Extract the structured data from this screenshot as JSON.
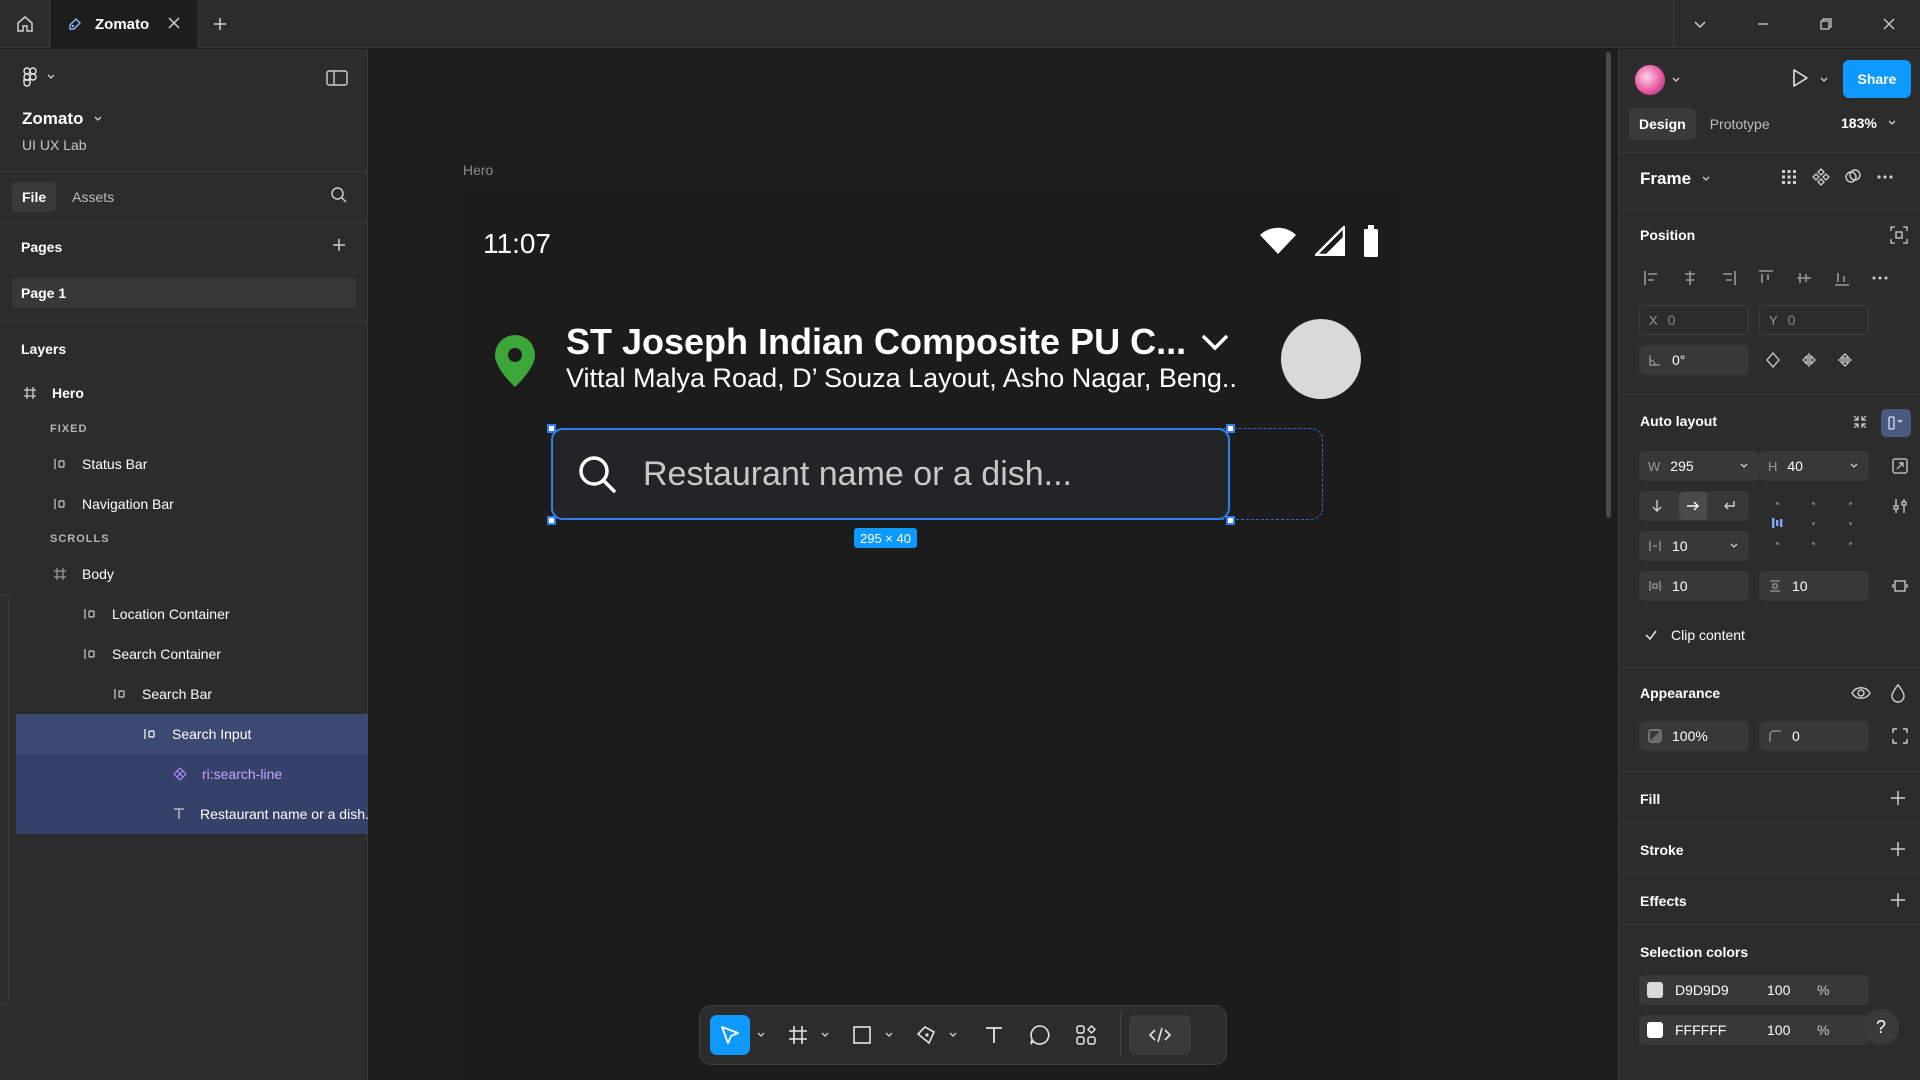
{
  "titlebar": {
    "tab_label": "Zomato",
    "icons": [
      "home-icon",
      "figma-file-icon",
      "close-icon",
      "plus-icon",
      "chevron-down-icon",
      "minimize-icon",
      "restore-icon",
      "close-window-icon"
    ]
  },
  "left_panel": {
    "file_name": "Zomato",
    "team_name": "UI UX Lab",
    "tabs": [
      "File",
      "Assets"
    ],
    "pages_heading": "Pages",
    "pages": [
      "Page 1"
    ],
    "layers_heading": "Layers",
    "layers": [
      {
        "label": "Hero",
        "type": "frame"
      },
      {
        "label": "FIXED",
        "type": "group-label"
      },
      {
        "label": "Status Bar",
        "type": "autolayout"
      },
      {
        "label": "Navigation Bar",
        "type": "autolayout"
      },
      {
        "label": "SCROLLS",
        "type": "group-label"
      },
      {
        "label": "Body",
        "type": "frame"
      },
      {
        "label": "Location Container",
        "type": "autolayout"
      },
      {
        "label": "Search Container",
        "type": "autolayout"
      },
      {
        "label": "Search Bar",
        "type": "autolayout"
      },
      {
        "label": "Search Input",
        "type": "autolayout"
      },
      {
        "label": "ri:search-line",
        "type": "component"
      },
      {
        "label": "Restaurant name or a dish...",
        "type": "text"
      }
    ]
  },
  "canvas": {
    "frame_label": "Hero",
    "status_time": "11:07",
    "location_title": "ST Joseph Indian Composite PU C...",
    "location_subtitle": "Vittal Malya Road, D’ Souza Layout, Asho Nagar, Beng..",
    "search_placeholder": "Restaurant name or a dish...",
    "selection_size": "295 × 40",
    "colors": {
      "pin": "#3ca63b",
      "avatar": "#d9d9d9",
      "selection": "#2f7ff0",
      "badge": "#0d99ff"
    }
  },
  "toolbar": {
    "tools": [
      "move-tool-icon",
      "frame-tool-icon",
      "rectangle-tool-icon",
      "pen-tool-icon",
      "text-tool-icon",
      "comment-tool-icon",
      "components-tool-icon",
      "dev-mode-icon"
    ]
  },
  "right_panel": {
    "share_label": "Share",
    "tabs": [
      "Design",
      "Prototype"
    ],
    "zoom": "183%",
    "frame_type": "Frame",
    "position": {
      "heading": "Position",
      "x_label": "X",
      "x_value": "0",
      "y_label": "Y",
      "y_value": "0",
      "rotation": "0°"
    },
    "auto_layout": {
      "heading": "Auto layout",
      "w_label": "W",
      "w_value": "295",
      "h_label": "H",
      "h_value": "40",
      "gap": "10",
      "padding_h": "10",
      "padding_v": "10",
      "clip_content": "Clip content"
    },
    "appearance": {
      "heading": "Appearance",
      "opacity": "100%",
      "radius": "0"
    },
    "fill_heading": "Fill",
    "stroke_heading": "Stroke",
    "effects_heading": "Effects",
    "selection_colors": {
      "heading": "Selection colors",
      "items": [
        {
          "hex": "D9D9D9",
          "opacity": "100",
          "pct": "%",
          "color": "#d9d9d9"
        },
        {
          "hex": "FFFFFF",
          "opacity": "100",
          "pct": "%",
          "color": "#ffffff"
        }
      ]
    },
    "help": "?"
  }
}
